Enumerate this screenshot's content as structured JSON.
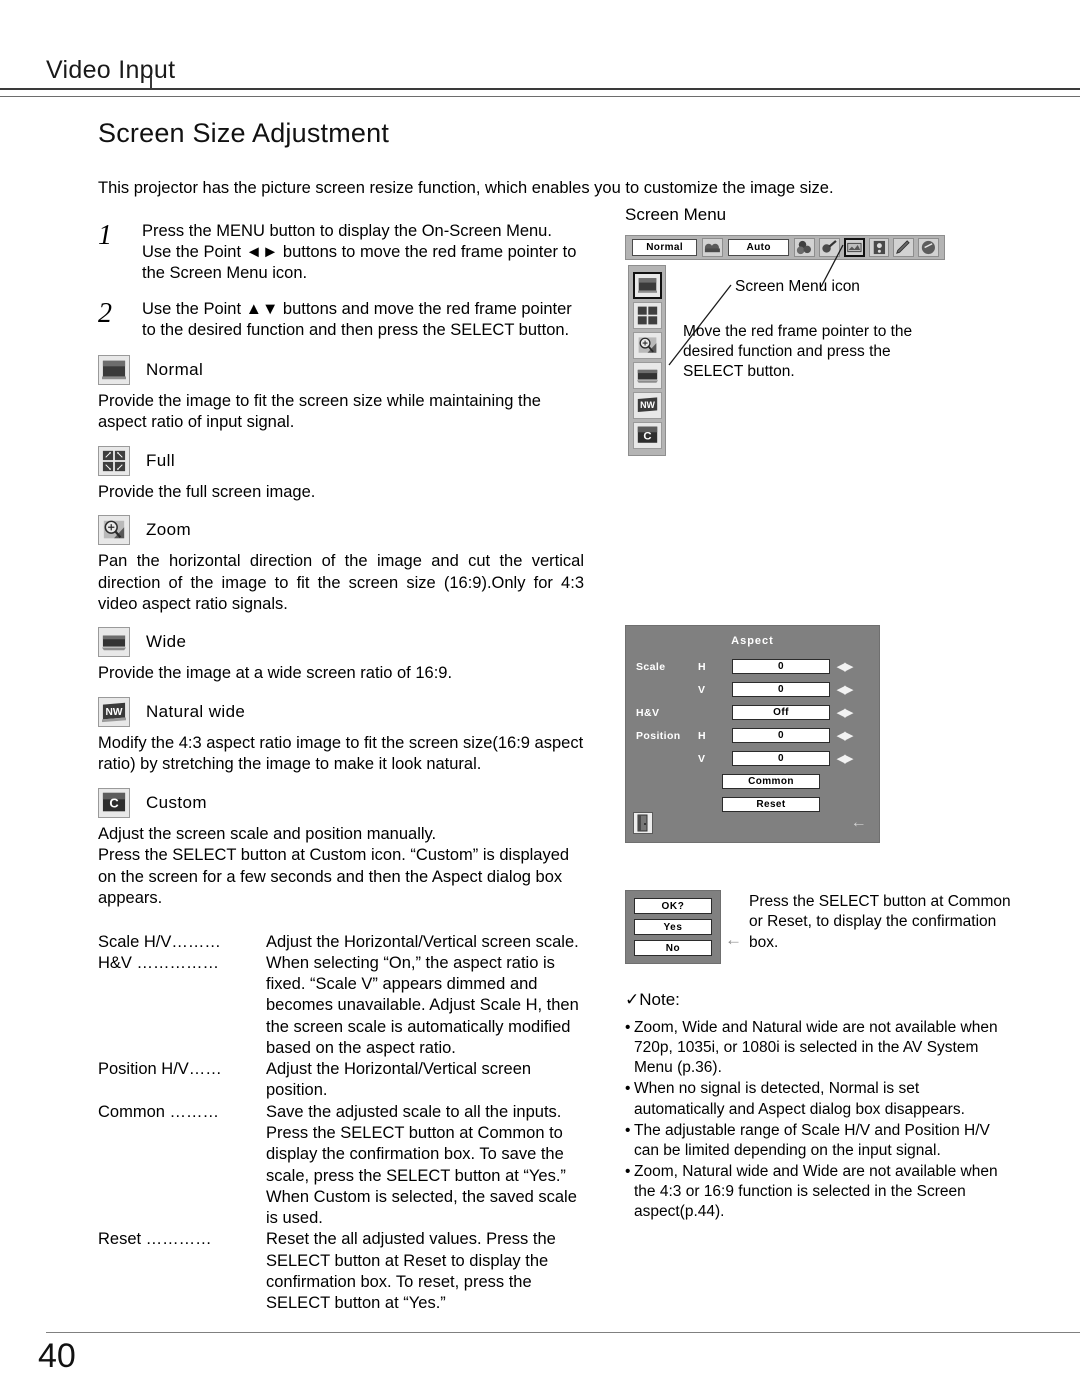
{
  "header": {
    "running_head": "Video Input"
  },
  "section": {
    "title": "Screen Size Adjustment",
    "intro": "This projector has the picture screen resize function, which enables you to customize the image size."
  },
  "steps": [
    {
      "number": "1",
      "text": "Press the MENU button to display the On-Screen Menu. Use the Point ◄► buttons to move the red frame pointer to the Screen Menu icon."
    },
    {
      "number": "2",
      "text": "Use the Point ▲▼ buttons and move the red frame pointer to the desired function and then press the SELECT button."
    }
  ],
  "modes": [
    {
      "icon": "normal-screen-icon",
      "label": "Normal",
      "description": "Provide the image to fit the screen size while maintaining the aspect ratio of input signal."
    },
    {
      "icon": "full-screen-icon",
      "label": "Full",
      "description": "Provide the full screen image."
    },
    {
      "icon": "zoom-icon",
      "label": "Zoom",
      "description": "Pan the horizontal direction of the image and cut the vertical direction of the image to fit the screen size (16:9).Only for 4:3 video aspect ratio signals."
    },
    {
      "icon": "wide-screen-icon",
      "label": "Wide",
      "description": "Provide the image at a wide screen ratio of 16:9."
    },
    {
      "icon": "natural-wide-icon",
      "label": "Natural wide",
      "description": "Modify the 4:3 aspect ratio image to fit the screen size(16:9 aspect ratio) by stretching the image to make it look natural."
    },
    {
      "icon": "custom-icon",
      "label": "Custom",
      "description": "Adjust the screen scale and position manually.\nPress the SELECT button at Custom icon. “Custom” is displayed on the screen for a few seconds and then the Aspect dialog box appears."
    }
  ],
  "definitions": [
    {
      "term": "Scale H/V………",
      "desc": "Adjust the Horizontal/Vertical screen scale."
    },
    {
      "term": "H&V ……………",
      "desc": "When selecting “On,” the aspect ratio is fixed. “Scale V” appears dimmed and becomes unavailable. Adjust Scale H, then the screen scale is automatically modified based on the aspect ratio."
    },
    {
      "term": "Position H/V……",
      "desc": "Adjust the Horizontal/Vertical screen position."
    },
    {
      "term": "Common ………",
      "desc": "Save the adjusted scale to all the inputs. Press the SELECT button at Common to display the confirmation box. To save the scale, press the SELECT button at “Yes.” When Custom is selected, the saved scale is used."
    },
    {
      "term": "Reset …………",
      "desc": "Reset the all adjusted values. Press the SELECT button at Reset to display the confirmation box. To reset, press the SELECT button at “Yes.”"
    }
  ],
  "screen_menu": {
    "title": "Screen Menu",
    "menubar": {
      "normal_label": "Normal",
      "auto_label": "Auto",
      "icons": [
        "video-source-icon",
        "color-adjust-icon",
        "image-adjust-icon",
        "screen-icon",
        "sound-icon",
        "setting-icon",
        "information-icon"
      ]
    },
    "strip_icons": [
      "normal-screen-icon",
      "full-screen-icon",
      "zoom-icon",
      "wide-screen-icon",
      "natural-wide-icon",
      "custom-icon"
    ],
    "callout_icon": "Screen Menu icon",
    "callout_pointer": "Move the red frame pointer to the desired function and press the SELECT button."
  },
  "aspect_dialog": {
    "title": "Aspect",
    "rows": [
      {
        "name": "Scale",
        "hv": "H",
        "value": "0"
      },
      {
        "name": "",
        "hv": "V",
        "value": "0"
      },
      {
        "name": "H&V",
        "hv": "",
        "value": "Off"
      },
      {
        "name": "Position",
        "hv": "H",
        "value": "0"
      },
      {
        "name": "",
        "hv": "V",
        "value": "0"
      }
    ],
    "buttons": [
      "Common",
      "Reset"
    ],
    "arrows": "◀▶",
    "quit_icon": "quit-door-icon",
    "back_arrow": "←"
  },
  "confirmation": {
    "ok_label": "OK?",
    "yes_label": "Yes",
    "no_label": "No",
    "arrow": "←",
    "text": "Press the SELECT button at Common or Reset, to display the confirmation box."
  },
  "note": {
    "heading": "✓Note:",
    "items": [
      "Zoom, Wide and Natural wide are not available when 720p, 1035i, or 1080i is selected in the AV System Menu (p.36).",
      "When no signal is detected, Normal is set automatically and Aspect dialog box disappears.",
      "The adjustable range of Scale H/V and Position H/V can be limited depending on the input signal.",
      "Zoom, Natural wide and Wide are not available when the 4:3 or 16:9 function is selected  in the Screen aspect(p.44)."
    ],
    "bullet": "•"
  },
  "footer": {
    "page_number": "40"
  }
}
